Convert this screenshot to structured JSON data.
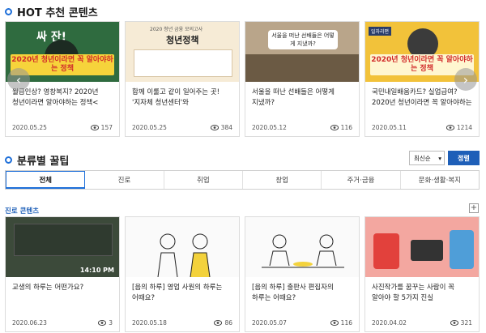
{
  "hot": {
    "title": "HOT 추천 콘텐츠",
    "cards": [
      {
        "caption": "월급인상? 영창복지? 2020년 청년이라면 알아야하는 정책<",
        "date": "2020.05.25",
        "views": "157",
        "banner": "2020년 청년이라면 꼭 알아야하는 정책",
        "tag": "싸 잔!"
      },
      {
        "caption": "함께 이룰고 같이 일어주는 곳! '지자체 청년센터'와",
        "date": "2020.05.25",
        "views": "384",
        "banner": "청년정책",
        "tag": "2020 청년 금융 모의고사"
      },
      {
        "caption": "서울을 떠난 선배들은 어떻게 지냈까?",
        "date": "2020.05.12",
        "views": "116",
        "banner": "서울을 떠난 선배들은 어떻게 지냈까?",
        "tag": ""
      },
      {
        "caption": "국민내일배움카드? 실업급여? 2020년 청년이라면 꼭 알아야하는",
        "date": "2020.05.11",
        "views": "1214",
        "banner": "2020년 청년이라면 꼭 알아야하는 정책",
        "tag": "일자리편"
      }
    ]
  },
  "category": {
    "title": "분류별 꿀팁",
    "sort_value": "최신순",
    "sort_button": "정렬",
    "tabs": [
      "전체",
      "진로",
      "취업",
      "창업",
      "주거·금융",
      "문화·생활·복지"
    ],
    "sub_title": "진로 콘텐츠",
    "plus": "+",
    "cards": [
      {
        "caption": "교생의 하루는 어떤가요?",
        "date": "2020.06.23",
        "views": "3",
        "overlay": "14:10 PM"
      },
      {
        "caption": "[음의 하루] 영업 사원의 하루는 어때요?",
        "date": "2020.05.18",
        "views": "86",
        "overlay": ""
      },
      {
        "caption": "[음의 하루] 출판사 편집자의 하루는 어때요?",
        "date": "2020.05.07",
        "views": "116",
        "overlay": ""
      },
      {
        "caption": "사진작가를 꿈꾸는 사람이 꼭 알아야 할 5가지 진실",
        "date": "2020.04.02",
        "views": "321",
        "overlay": ""
      }
    ]
  },
  "icons": {
    "prev": "‹",
    "next": "›",
    "dropdown": "▾"
  }
}
